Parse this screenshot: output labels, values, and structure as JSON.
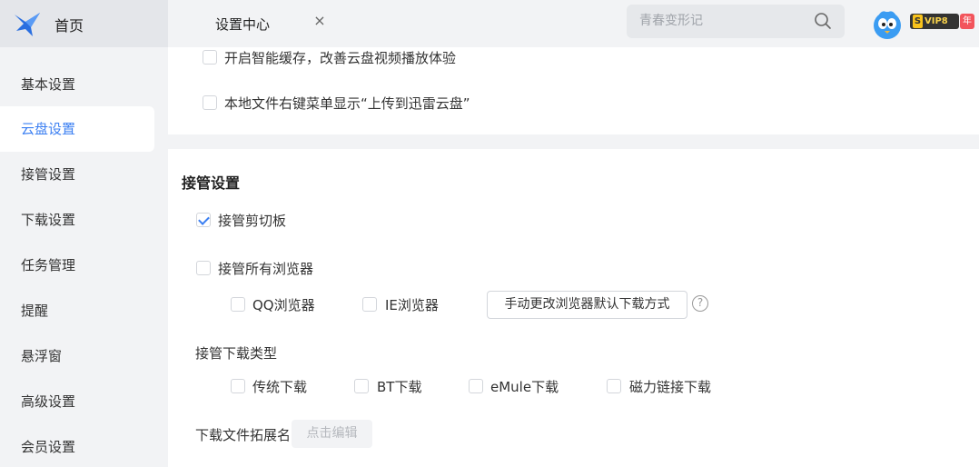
{
  "header": {
    "home_label": "首页",
    "tab_label": "设置中心",
    "tab_close": "×",
    "search_placeholder": "青春变形记",
    "vip_label": "VIP8",
    "vip_bolt": "S",
    "year_label": "年"
  },
  "sidebar": {
    "items": [
      {
        "label": "基本设置"
      },
      {
        "label": "云盘设置"
      },
      {
        "label": "接管设置"
      },
      {
        "label": "下载设置"
      },
      {
        "label": "任务管理"
      },
      {
        "label": "提醒"
      },
      {
        "label": "悬浮窗"
      },
      {
        "label": "高级设置"
      },
      {
        "label": "会员设置"
      }
    ],
    "active": "云盘设置"
  },
  "cloud": {
    "smart_cache": "开启智能缓存，改善云盘视频播放体验",
    "context_menu": "本地文件右键菜单显示“上传到迅雷云盘”"
  },
  "takeover": {
    "title": "接管设置",
    "clipboard": "接管剪切板",
    "all_browsers": "接管所有浏览器",
    "qq_browser": "QQ浏览器",
    "ie_browser": "IE浏览器",
    "change_default_button": "手动更改浏览器默认下载方式",
    "help": "?",
    "download_types_label": "接管下载类型",
    "type_traditional": "传统下载",
    "type_bt": "BT下载",
    "type_emule": "eMule下载",
    "type_magnet": "磁力链接下载",
    "ext_label": "下载文件拓展名",
    "ext_button": "点击编辑"
  },
  "colors": {
    "accent": "#3b7ff2",
    "vip_gold": "#f8d24b",
    "year_red": "#f2545b"
  }
}
